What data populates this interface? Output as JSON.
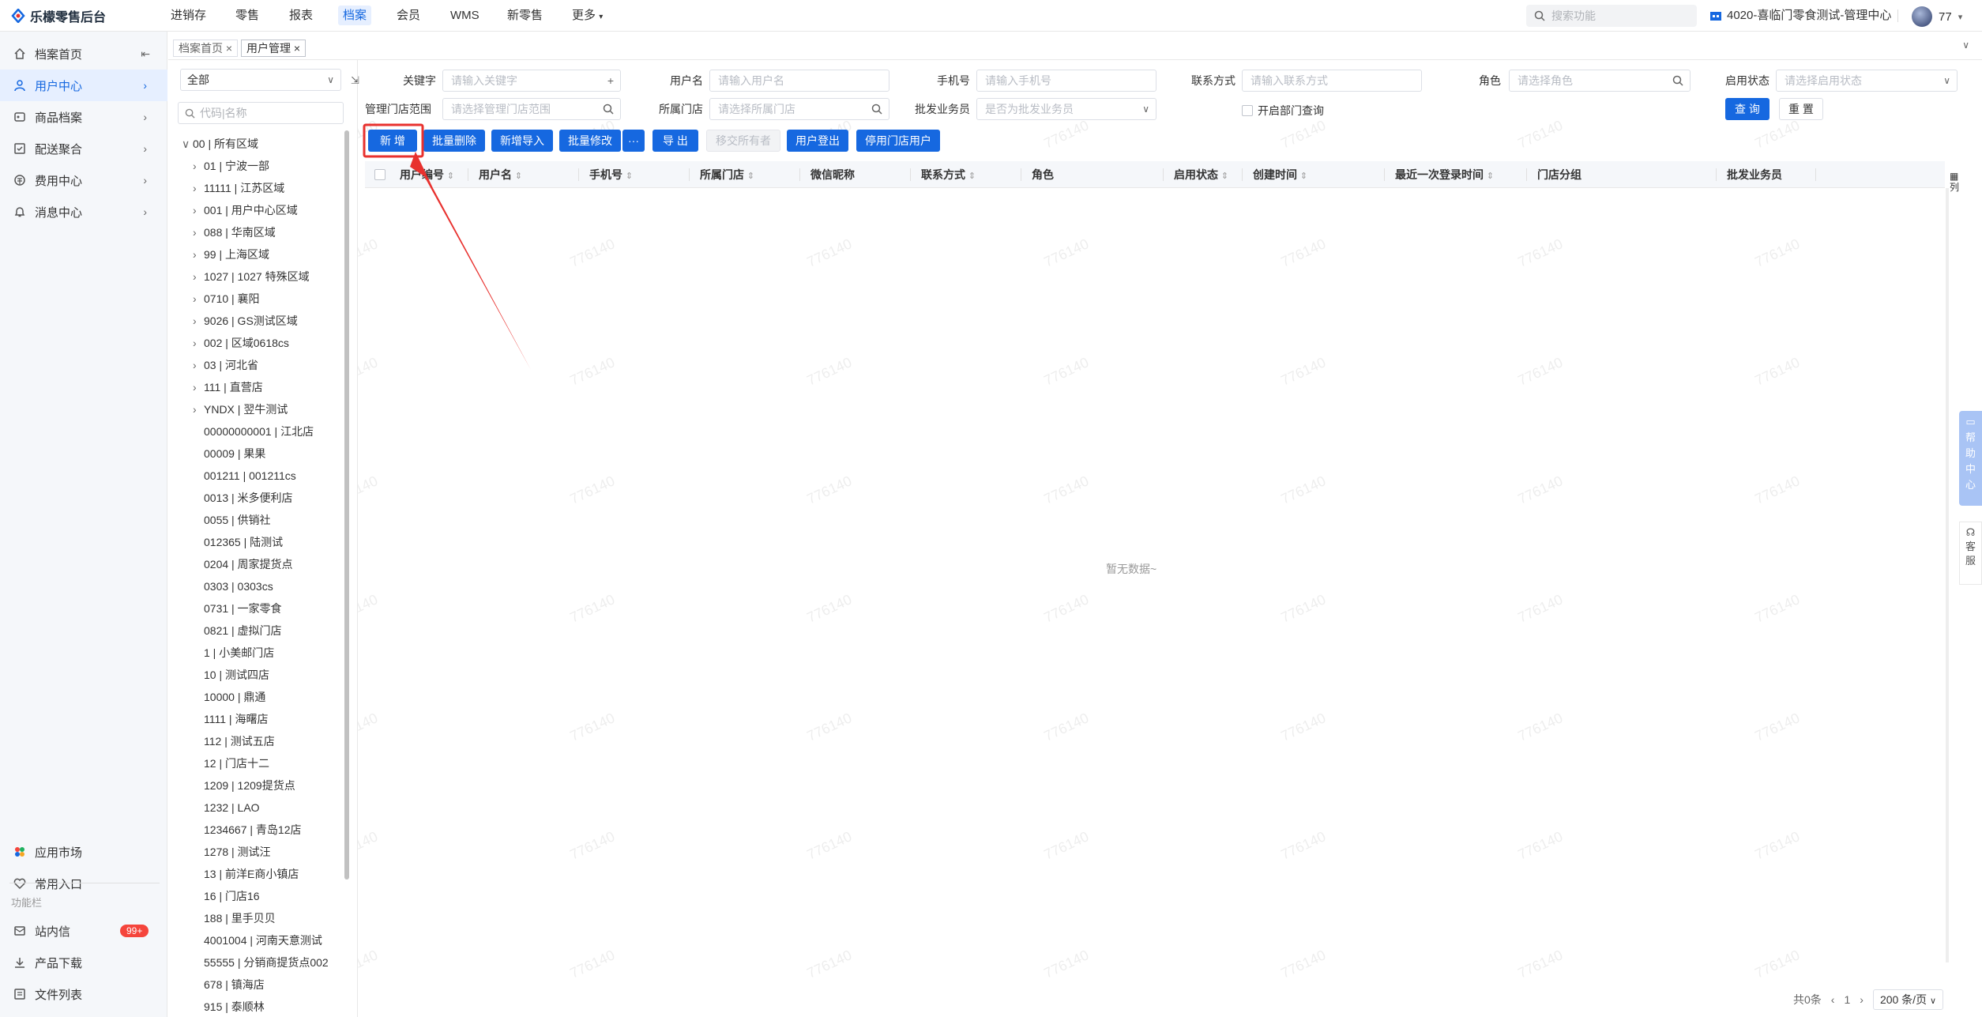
{
  "app": {
    "title": "乐檬零售后台"
  },
  "topnav": [
    "进销存",
    "零售",
    "报表",
    "档案",
    "会员",
    "WMS",
    "新零售",
    "更多"
  ],
  "search": {
    "placeholder": "搜索功能"
  },
  "store": {
    "name": "4020-喜临门零食测试-管理中心"
  },
  "user": {
    "name": "77"
  },
  "sidebar": {
    "items": [
      "档案首页",
      "用户中心",
      "商品档案",
      "配送聚合",
      "费用中心",
      "消息中心"
    ],
    "bottom": [
      "应用市场",
      "常用入口"
    ],
    "section_label": "功能栏",
    "func": [
      "站内信",
      "产品下载",
      "文件列表"
    ],
    "badge": "99+"
  },
  "tabs": [
    "档案首页",
    "用户管理"
  ],
  "tree": {
    "select_value": "全部",
    "code_placeholder": "代码|名称",
    "root": "00 | 所有区域",
    "nodes": [
      "01 | 宁波一部",
      "11111 | 江苏区域",
      "001 | 用户中心区域",
      "088 | 华南区域",
      "99 | 上海区域",
      "1027 | 1027 特殊区域",
      "0710 | 襄阳",
      "9026 | GS测试区域",
      "002 | 区域0618cs",
      "03 | 河北省",
      "111 | 直营店",
      "YNDX | 翌牛测试"
    ],
    "leaves": [
      "00000000001 | 江北店",
      "00009 | 果果",
      "001211 | 001211cs",
      "0013 | 米多便利店",
      "0055 | 供销社",
      "012365 | 陆测试",
      "0204 | 周家提货点",
      "0303 | 0303cs",
      "0731 | 一家零食",
      "0821 | 虚拟门店",
      "1 | 小美邮门店",
      "10 | 测试四店",
      "10000 | 鼎通",
      "1111 | 海曙店",
      "112 | 测试五店",
      "12 | 门店十二",
      "1209 | 1209提货点",
      "1232 | LAO",
      "1234667 | 青岛12店",
      "1278 | 测试汪",
      "13 | 前洋E商小镇店",
      "16 | 门店16",
      "188 | 里手贝贝",
      "4001004 | 河南天意测试",
      "55555 | 分销商提货点002",
      "678 | 镇海店",
      "915 | 泰顺林"
    ]
  },
  "filters": {
    "keyword": {
      "label": "关键字",
      "placeholder": "请输入关键字"
    },
    "username": {
      "label": "用户名",
      "placeholder": "请输入用户名"
    },
    "phone": {
      "label": "手机号",
      "placeholder": "请输入手机号"
    },
    "contact": {
      "label": "联系方式",
      "placeholder": "请输入联系方式"
    },
    "role": {
      "label": "角色",
      "placeholder": "请选择角色"
    },
    "status": {
      "label": "启用状态",
      "placeholder": "请选择启用状态"
    },
    "manage_scope": {
      "label": "管理门店范围",
      "placeholder": "请选择管理门店范围"
    },
    "store": {
      "label": "所属门店",
      "placeholder": "请选择所属门店"
    },
    "wholesale": {
      "label": "批发业务员",
      "placeholder": "是否为批发业务员"
    },
    "dept_query": {
      "label": "开启部门查询"
    },
    "query_btn": "查 询",
    "reset_btn": "重 置"
  },
  "actions": [
    "新 增",
    "批量删除",
    "新增导入",
    "批量修改",
    "···",
    "导 出",
    "移交所有者",
    "用户登出",
    "停用门店用户"
  ],
  "table": {
    "columns": [
      "用户编号",
      "用户名",
      "手机号",
      "所属门店",
      "微信昵称",
      "联系方式",
      "角色",
      "启用状态",
      "创建时间",
      "最近一次登录时间",
      "门店分组",
      "批发业务员"
    ],
    "empty_text": "暂无数据~",
    "column_setting": "列"
  },
  "pager": {
    "total": "共0条",
    "page": "1",
    "page_size": "200 条/页"
  },
  "float": {
    "help": "帮助中心",
    "service": "客服"
  },
  "watermark": "776140",
  "colors": {
    "primary": "#1668e0",
    "badge": "#f5453c",
    "annotation": "#e8312e"
  }
}
